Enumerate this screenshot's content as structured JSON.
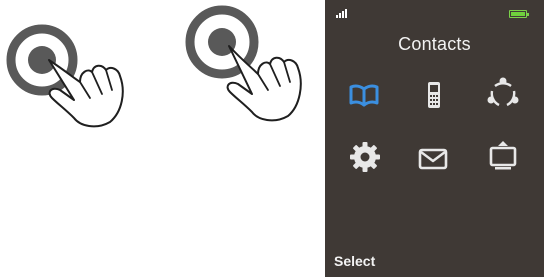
{
  "screen": {
    "title": "Contacts",
    "softkey_left": "Select",
    "menu_items": [
      {
        "icon": "phonebook-icon",
        "selected": true
      },
      {
        "icon": "mobile-phone-icon",
        "selected": false
      },
      {
        "icon": "share-icon",
        "selected": false
      },
      {
        "icon": "settings-gear-icon",
        "selected": false
      },
      {
        "icon": "message-envelope-icon",
        "selected": false
      },
      {
        "icon": "display-export-icon",
        "selected": false
      }
    ]
  },
  "gestures": [
    {
      "icon": "tap-gesture-icon"
    },
    {
      "icon": "tap-gesture-icon"
    }
  ],
  "colors": {
    "gesture_ring": "#595959",
    "screen_bg": "#3f3935",
    "selected_icon": "#3b8fe0",
    "icon": "#e8e8e8",
    "battery": "#6fcf3d"
  }
}
